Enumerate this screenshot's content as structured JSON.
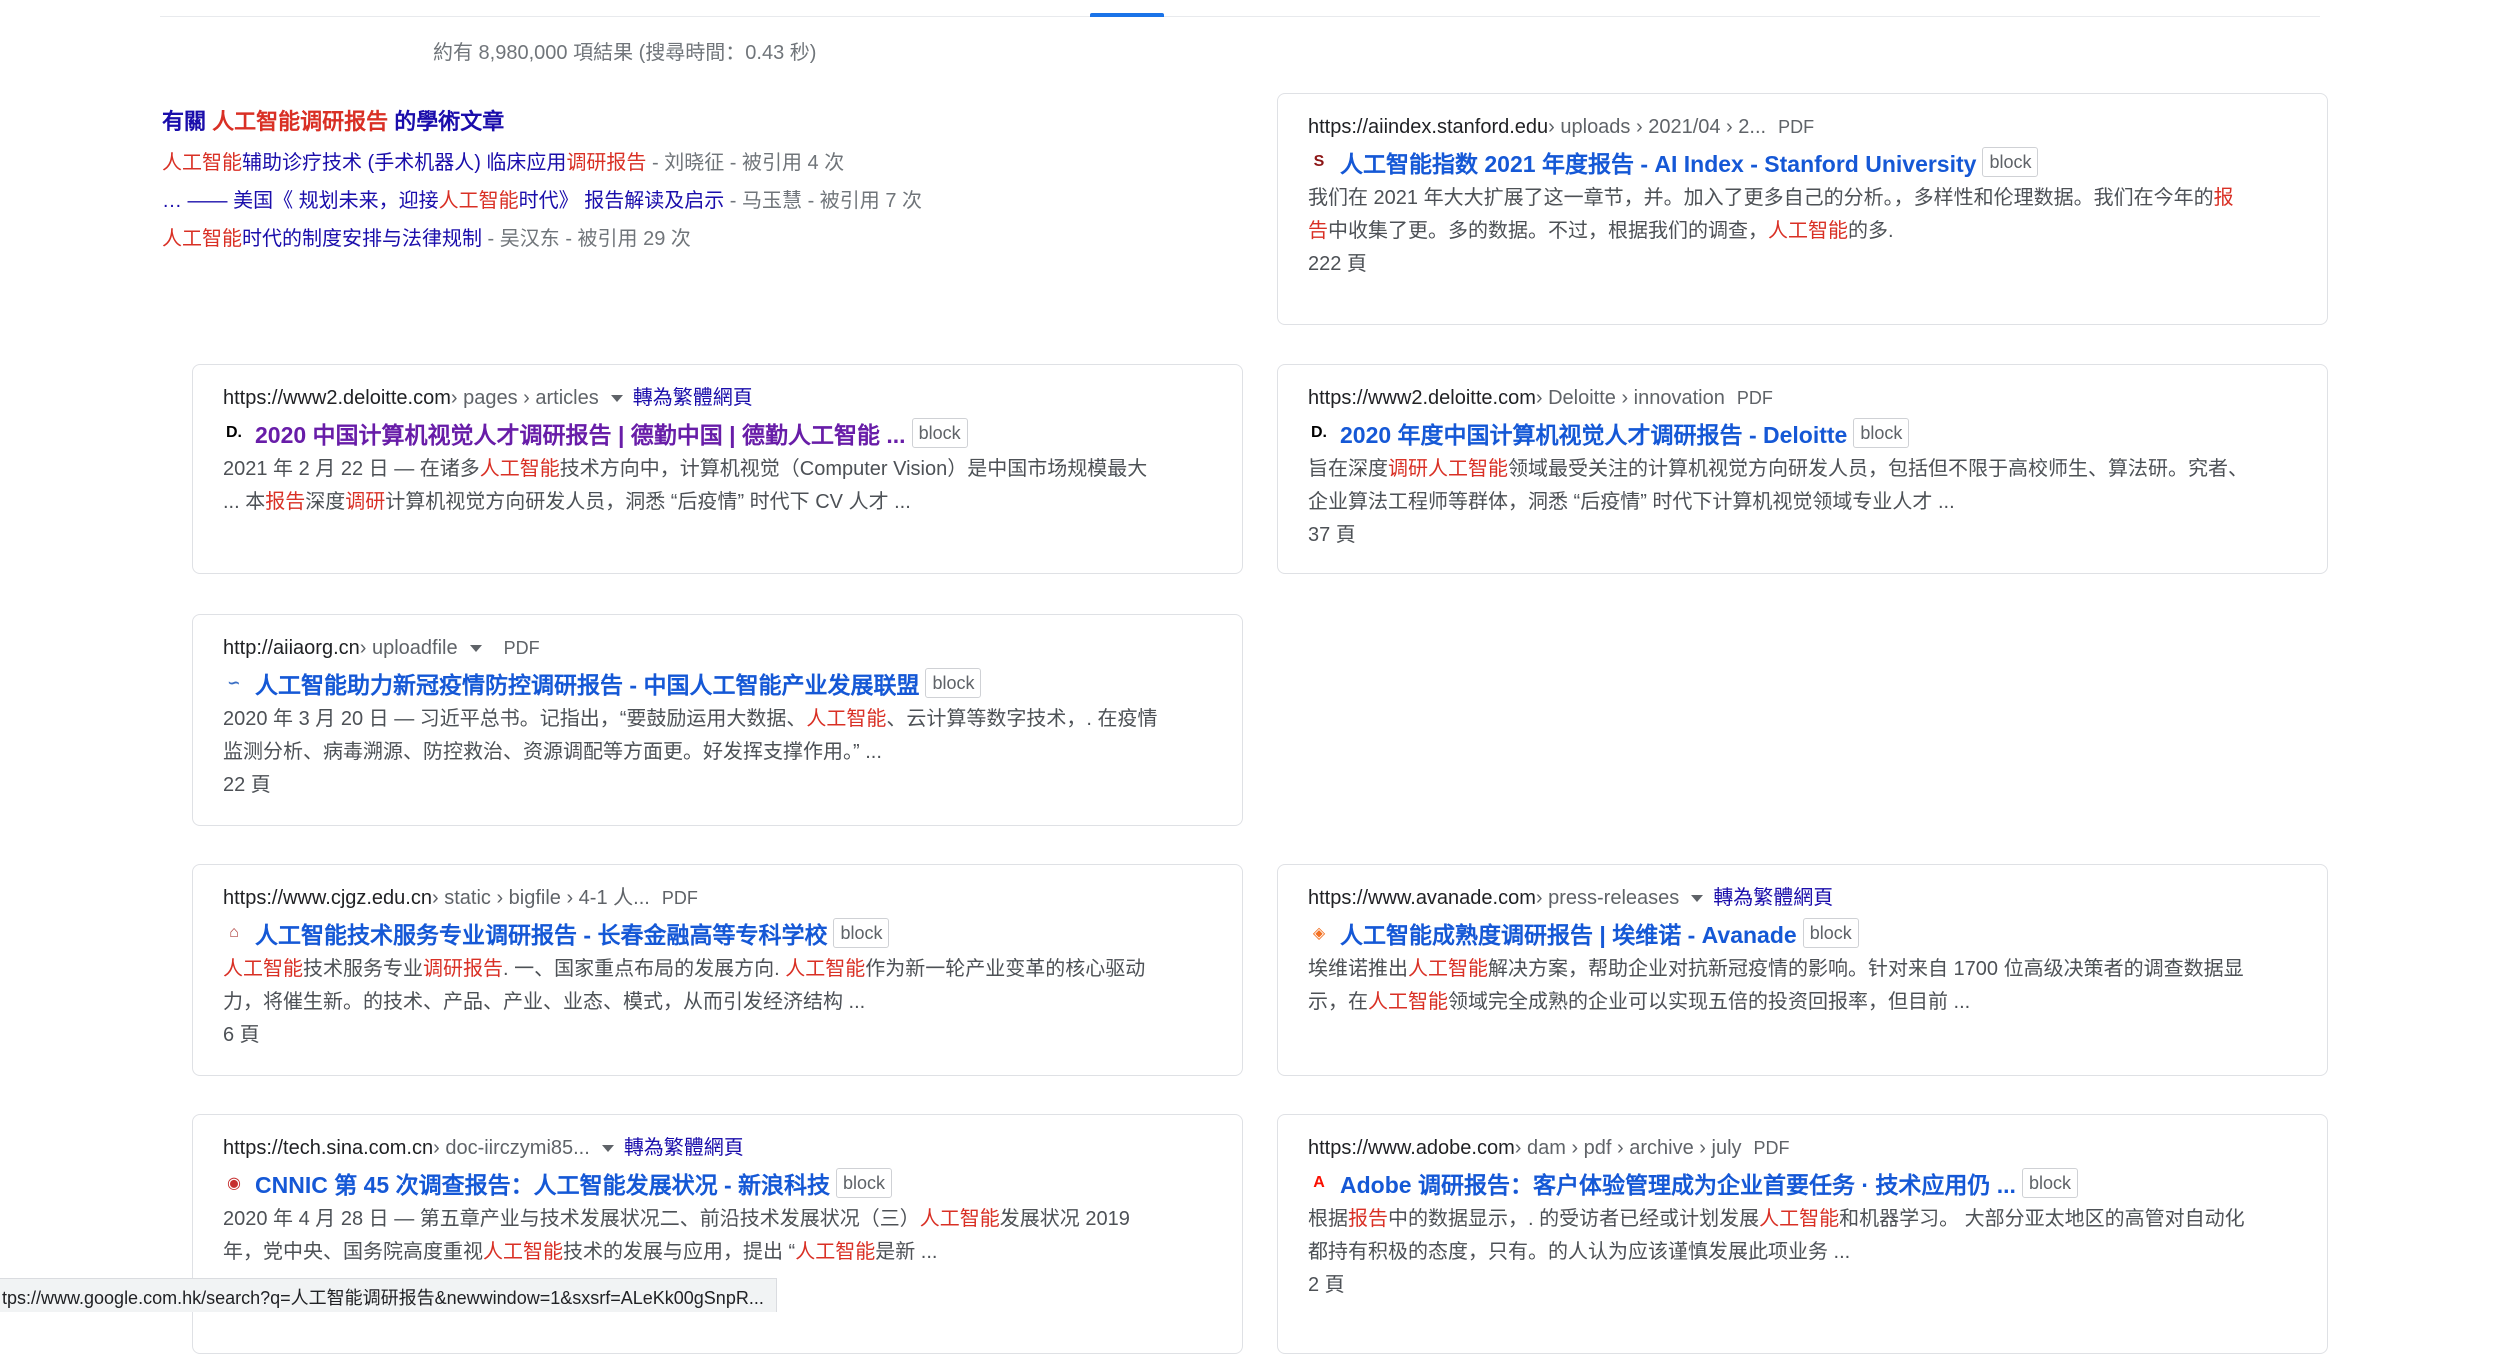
{
  "stats": "約有 8,980,000 項結果 (搜尋時間：0.43 秒)",
  "scholar": {
    "heading_prefix": "有關 ",
    "heading_query": "人工智能调研报告",
    "heading_suffix": " 的學術文章",
    "items": [
      {
        "p1_hl": "人工智能",
        "p2": "辅助诊疗技术 (手术机器人) 临床应用",
        "p3_hl": "调研报告",
        "p4": "",
        "meta": " - 刘晓征 - 被引用 4 次"
      },
      {
        "p1_hl": "",
        "p2": "… —— 美国《 规划未来，迎接",
        "p3_hl": "人工智能",
        "p4": "时代》 报告解读及启示",
        "meta": " - 马玉慧 - 被引用 7 次"
      },
      {
        "p1_hl": "人工智能",
        "p2": "时代的制度安排与法律规制",
        "p3_hl": "",
        "p4": "",
        "meta": " - 吴汉东 - 被引用 29 次"
      }
    ]
  },
  "block_label": "block",
  "results": [
    {
      "url": "https://aiindex.stanford.edu",
      "crumbs": " › uploads › 2021/04 › 2...",
      "pdf": "PDF",
      "translate": "",
      "favicon": {
        "name": "stanford-favicon-icon",
        "glyph": "S",
        "color": "#8c1515"
      },
      "title_parts": [
        {
          "t": "人工智能指数 2021 年度报告 - AI Index - Stanford University"
        }
      ],
      "snippet_lines": [
        [
          {
            "t": "我们在 2021 年大大扩展了这一章节，并。加入了更多自己的分析。，多样性和伦理数据。我们在今年的"
          },
          {
            "t": "报",
            "hl": true
          }
        ],
        [
          {
            "t": "告",
            "hl": true
          },
          {
            "t": "中收集了更。多的数据。不过，根据我们的调查，"
          },
          {
            "t": "人工智能",
            "hl": true
          },
          {
            "t": "的多."
          }
        ]
      ],
      "pages": "222 頁"
    },
    {
      "url": "https://www2.deloitte.com",
      "crumbs": " › pages › articles",
      "pdf": "",
      "translate": "轉為繁體網頁",
      "favicon": {
        "name": "deloitte-favicon-icon",
        "glyph": "D.",
        "color": "#000000"
      },
      "visited": true,
      "title_parts": [
        {
          "t": "2020 中国计算机视觉人才调研报告 | 德勤中国 | 德勤人工智能 ..."
        }
      ],
      "snippet_lines": [
        [
          {
            "t": "2021 年 2 月 22 日 — 在诸多"
          },
          {
            "t": "人工智能",
            "hl": true
          },
          {
            "t": "技术方向中，计算机视觉（Computer Vision）是中国市场规模最大"
          }
        ],
        [
          {
            "t": "... 本"
          },
          {
            "t": "报告",
            "hl": true
          },
          {
            "t": "深度"
          },
          {
            "t": "调研",
            "hl": true
          },
          {
            "t": "计算机视觉方向研发人员，洞悉 “后疫情” 时代下 CV 人才 ..."
          }
        ]
      ],
      "pages": ""
    },
    {
      "url": "https://www2.deloitte.com",
      "crumbs": " › Deloitte › innovation",
      "pdf": "PDF",
      "translate": "",
      "favicon": {
        "name": "deloitte-favicon-icon",
        "glyph": "D.",
        "color": "#000000"
      },
      "title_parts": [
        {
          "t": "2020 年度中国计算机视觉人才调研报告 - Deloitte"
        }
      ],
      "snippet_lines": [
        [
          {
            "t": "旨在深度"
          },
          {
            "t": "调研人工智能",
            "hl": true
          },
          {
            "t": "领域最受关注的计算机视觉方向研发人员，包括但不限于高校师生、算法研。究者、"
          }
        ],
        [
          {
            "t": "企业算法工程师等群体，洞悉 “后疫情” 时代下计算机视觉领域专业人才 ..."
          }
        ]
      ],
      "pages": "37 頁"
    },
    {
      "url": "http://aiiaorg.cn",
      "crumbs": " › uploadfile",
      "pdf": "PDF",
      "translate": "",
      "favicon": {
        "name": "aiia-favicon-icon",
        "glyph": "∽",
        "color": "#3a6fc4"
      },
      "title_parts": [
        {
          "t": "人工智能助力新冠疫情防控调研报告 - 中国人工智能产业发展联盟"
        }
      ],
      "snippet_lines": [
        [
          {
            "t": "2020 年 3 月 20 日 — 习近平总书。记指出，“要鼓励运用大数据、"
          },
          {
            "t": "人工智能",
            "hl": true
          },
          {
            "t": "、云计算等数字技术，. 在疫情"
          }
        ],
        [
          {
            "t": "监测分析、病毒溯源、防控救治、资源调配等方面更。好发挥支撑作用。” ..."
          }
        ]
      ],
      "pages": "22 頁"
    },
    {
      "url": "https://www.cjgz.edu.cn",
      "crumbs": " › static › bigfile › 4-1 人...",
      "pdf": "PDF",
      "translate": "",
      "favicon": {
        "name": "cjgz-favicon-icon",
        "glyph": "⌂",
        "color": "#b0413e"
      },
      "title_parts": [
        {
          "t": "人工智能技术服务专业调研报告 - 长春金融高等专科学校"
        }
      ],
      "snippet_lines": [
        [
          {
            "t": "人工智能",
            "hl": true
          },
          {
            "t": "技术服务专业"
          },
          {
            "t": "调研报告",
            "hl": true
          },
          {
            "t": ". 一、国家重点布局的发展方向. "
          },
          {
            "t": "人工智能",
            "hl": true
          },
          {
            "t": "作为新一轮产业变革的核心驱动"
          }
        ],
        [
          {
            "t": "力，将催生新。的技术、产品、产业、业态、模式，从而引发经济结构 ..."
          }
        ]
      ],
      "pages": "6 頁"
    },
    {
      "url": "https://www.avanade.com",
      "crumbs": " › press-releases",
      "pdf": "",
      "translate": "轉為繁體網頁",
      "favicon": {
        "name": "avanade-favicon-icon",
        "glyph": "◈",
        "color": "#f37021"
      },
      "title_parts": [
        {
          "t": "人工智能成熟度调研报告 | 埃维诺 - Avanade"
        }
      ],
      "snippet_lines": [
        [
          {
            "t": "埃维诺推出"
          },
          {
            "t": "人工智能",
            "hl": true
          },
          {
            "t": "解决方案，帮助企业对抗新冠疫情的影响。针对来自 1700 位高级决策者的调查数据显"
          }
        ],
        [
          {
            "t": "示，在"
          },
          {
            "t": "人工智能",
            "hl": true
          },
          {
            "t": "领域完全成熟的企业可以实现五倍的投资回报率，但目前 ..."
          }
        ]
      ],
      "pages": ""
    },
    {
      "url": "https://tech.sina.com.cn",
      "crumbs": " › doc-iirczymi85...",
      "pdf": "",
      "translate": "轉為繁體網頁",
      "favicon": {
        "name": "sina-favicon-icon",
        "glyph": "◉",
        "color": "#c62f2f"
      },
      "title_parts": [
        {
          "t": "CNNIC 第 45 次调查报告：人工智能发展状况 - 新浪科技"
        }
      ],
      "snippet_lines": [
        [
          {
            "t": "2020 年 4 月 28 日 — 第五章产业与技术发展状况二、前沿技术发展状况（三）"
          },
          {
            "t": "人工智能",
            "hl": true
          },
          {
            "t": "发展状况 2019"
          }
        ],
        [
          {
            "t": "年，党中央、国务院高度重视"
          },
          {
            "t": "人工智能",
            "hl": true
          },
          {
            "t": "技术的发展与应用，提出 “"
          },
          {
            "t": "人工智能",
            "hl": true
          },
          {
            "t": "是新 ..."
          }
        ]
      ],
      "pages": ""
    },
    {
      "url": "https://www.adobe.com",
      "crumbs": " › dam › pdf › archive › july",
      "pdf": "PDF",
      "translate": "",
      "favicon": {
        "name": "adobe-favicon-icon",
        "glyph": "A",
        "color": "#fa0f00"
      },
      "title_parts": [
        {
          "t": "Adobe 调研报告：客户体验管理成为企业首要任务 · 技术应用仍 ..."
        }
      ],
      "snippet_lines": [
        [
          {
            "t": "根据"
          },
          {
            "t": "报告",
            "hl": true
          },
          {
            "t": "中的数据显示，. 的受访者已经或计划发展"
          },
          {
            "t": "人工智能",
            "hl": true
          },
          {
            "t": "和机器学习。 大部分亚太地区的高管对自动化"
          }
        ],
        [
          {
            "t": "都持有积极的态度，只有。的人认为应该谨慎发展此项业务 ..."
          }
        ]
      ],
      "pages": "2 頁"
    }
  ],
  "status_url": "tps://www.google.com.hk/search?q=人工智能调研报告&newwindow=1&sxsrf=ALeKk00gSnpR..."
}
